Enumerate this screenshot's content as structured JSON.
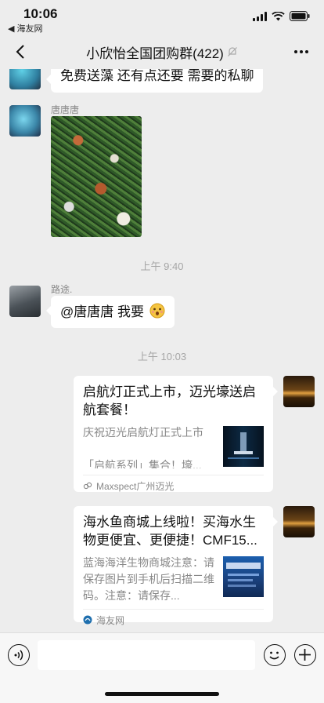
{
  "status_bar": {
    "time": "10:06",
    "back_app": "◀ 海友网"
  },
  "nav": {
    "title": "小欣怡全国团购群(422)"
  },
  "messages": {
    "partial_text": "免费送藻 还有点还要  需要的私聊",
    "msg2_sender": "唐唐唐",
    "timestamp1": "上午 9:40",
    "msg3_sender": "路途.",
    "msg3_text": "@唐唐唐 我要",
    "timestamp2": "上午 10:03"
  },
  "cards": [
    {
      "title": "启航灯正式上市，迈光壕送启航套餐！",
      "desc": "庆祝迈光启航灯正式上市\n\n「启航系列」集合！壕...",
      "source": "Maxspect广州迈光"
    },
    {
      "title": "海水鱼商城上线啦！买海水生物更便宜、更便捷！CMF15...",
      "desc": "蓝海海洋生物商城注意：请保存图片到手机后扫描二维码。注意：请保存...",
      "source": "海友网"
    }
  ],
  "colors": {
    "background": "#ededed",
    "bubble": "#ffffff",
    "timestamp": "#a6a6a6"
  }
}
